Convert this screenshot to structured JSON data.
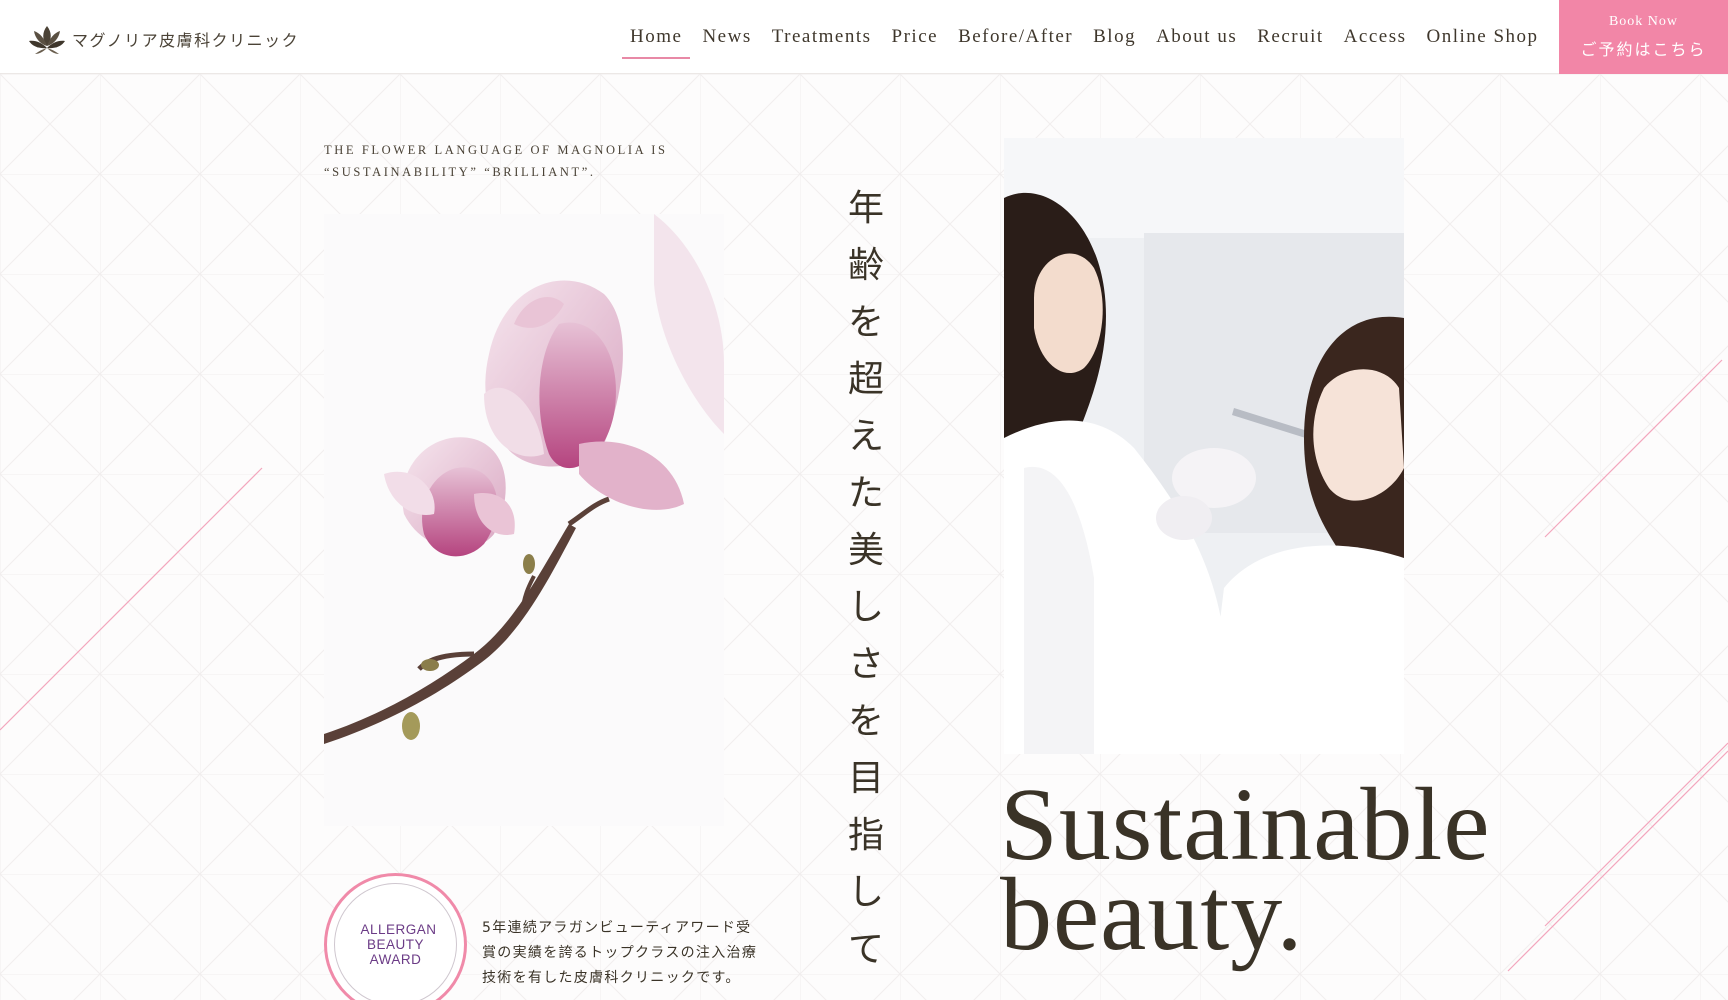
{
  "header": {
    "logo_text": "マグノリア皮膚科クリニック",
    "nav": [
      {
        "label": "Home",
        "active": true
      },
      {
        "label": "News"
      },
      {
        "label": "Treatments"
      },
      {
        "label": "Price"
      },
      {
        "label": "Before/After"
      },
      {
        "label": "Blog"
      },
      {
        "label": "About us"
      },
      {
        "label": "Recruit"
      },
      {
        "label": "Access"
      },
      {
        "label": "Online Shop"
      }
    ],
    "book": {
      "en": "Book Now",
      "jp": "ご予約はこちら"
    }
  },
  "hero": {
    "tagline": "THE FLOWER LANGUAGE OF MAGNOLIA IS “SUSTAINABILITY” “BRILLIANT”.",
    "vertical_copy": "年齢を超えた美しさを目指して",
    "headline_line1": "Sustainable",
    "headline_line2": "beauty.",
    "award_label": "ALLERGAN BEAUTY AWARD",
    "award_text": "5年連続アラガンビューティアワード受賞の実績を誇るトップクラスの注入治療技術を有した皮膚科クリニックです。"
  },
  "colors": {
    "accent": "#f286a7",
    "text": "#3a3327",
    "award_purple": "#6b3b86"
  }
}
